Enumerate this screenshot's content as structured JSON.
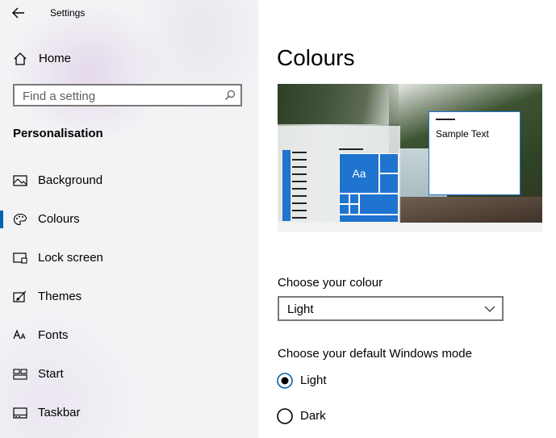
{
  "window": {
    "title": "Settings"
  },
  "sidebar": {
    "home_label": "Home",
    "search_placeholder": "Find a setting",
    "section_heading": "Personalisation",
    "items": [
      {
        "label": "Background",
        "icon": "picture-icon",
        "selected": false
      },
      {
        "label": "Colours",
        "icon": "palette-icon",
        "selected": true
      },
      {
        "label": "Lock screen",
        "icon": "lock-screen-icon",
        "selected": false
      },
      {
        "label": "Themes",
        "icon": "themes-icon",
        "selected": false
      },
      {
        "label": "Fonts",
        "icon": "fonts-icon",
        "selected": false
      },
      {
        "label": "Start",
        "icon": "start-icon",
        "selected": false
      },
      {
        "label": "Taskbar",
        "icon": "taskbar-icon",
        "selected": false
      }
    ]
  },
  "main": {
    "title": "Colours",
    "preview": {
      "tile_text": "Aa",
      "sample_text": "Sample Text"
    },
    "choose_colour": {
      "label": "Choose your colour",
      "selected": "Light"
    },
    "windows_mode": {
      "label": "Choose your default Windows mode",
      "options": [
        {
          "label": "Light",
          "checked": true
        },
        {
          "label": "Dark",
          "checked": false
        }
      ]
    }
  },
  "colors": {
    "accent": "#1f74cf",
    "selection_indicator": "#0063b1"
  }
}
